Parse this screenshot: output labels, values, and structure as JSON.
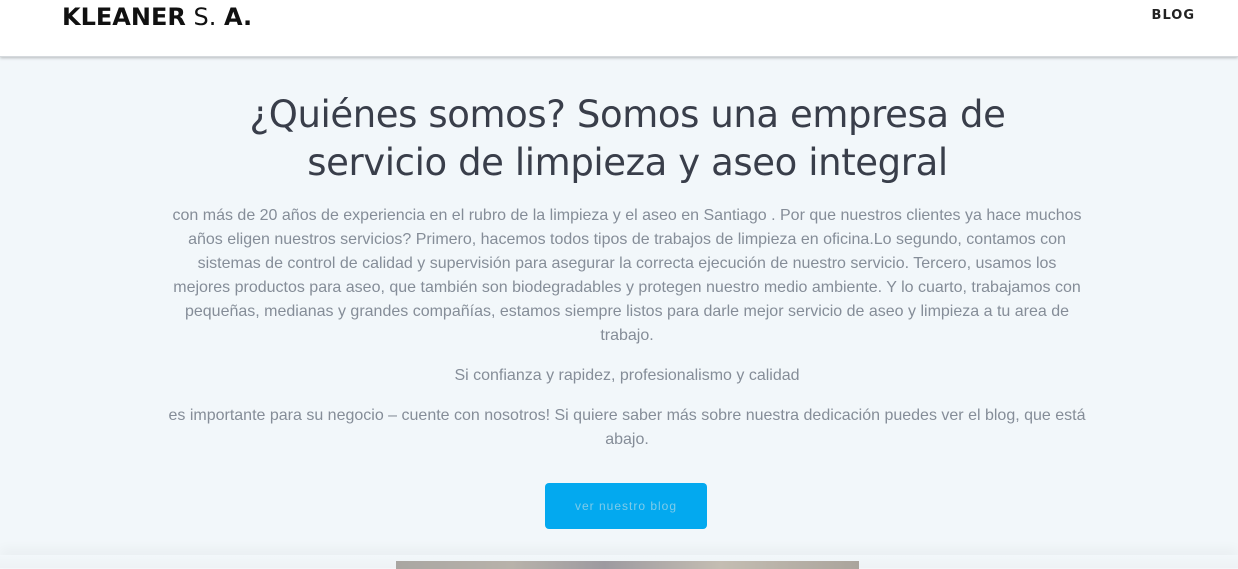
{
  "header": {
    "logo": {
      "part1": "KLEANER",
      "part2": "S.",
      "part3": "A."
    },
    "nav_blog": "BLOG"
  },
  "hero": {
    "title": "¿Quiénes somos? Somos una empresa de servicio de limpieza y aseo integral",
    "paragraph_1": "con más de 20 años de experiencia en el rubro de la limpieza y el aseo en Santiago . Por que nuestros clientes ya hace muchos años eligen nuestros servicios? Primero, hacemos todos tipos de trabajos de limpieza en oficina.Lo segundo, contamos con sistemas de control de calidad y supervisión para asegurar la correcta ejecución de nuestro servicio. Tercero, usamos los mejores productos para aseo, que también son biodegradables y protegen nuestro medio ambiente. Y lo cuarto, trabajamos con pequeñas, medianas y grandes compañías,   estamos  siempre listos para darle mejor servicio de aseo y limpieza a tu area de trabajo.",
    "paragraph_2": "Si confianza y rapidez, profesionalismo y calidad",
    "paragraph_3": "es importante para su negocio – cuente con nosotros! Si quiere saber más sobre nuestra dedicación puedes ver el blog, que está abajo.",
    "cta_label": "ver nuestro blog"
  },
  "colors": {
    "accent": "#03a9ef",
    "title": "#393e4a",
    "body_text": "#858d98",
    "background": "#f2f7fa"
  }
}
